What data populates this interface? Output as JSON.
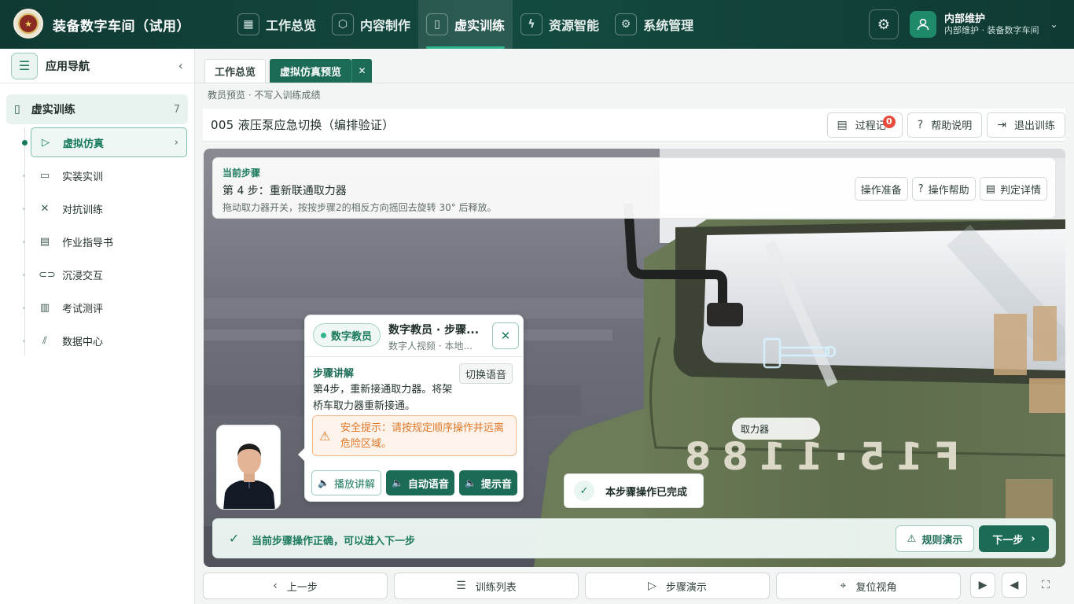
{
  "app": {
    "title": "装备数字车间（试用）",
    "logo_icon": "emblem-icon",
    "logo_glyph": "★"
  },
  "nav": {
    "items": [
      {
        "label": "工作总览",
        "icon": "grid-icon",
        "glyph": "▦"
      },
      {
        "label": "内容制作",
        "icon": "cube-icon",
        "glyph": "⬡"
      },
      {
        "label": "虚实训练",
        "icon": "book-icon",
        "glyph": "▯"
      },
      {
        "label": "资源智能",
        "icon": "bolt-icon",
        "glyph": "ϟ"
      },
      {
        "label": "系统管理",
        "icon": "gear-icon",
        "glyph": "⚙"
      }
    ],
    "active_index": 2
  },
  "header": {
    "settings_glyph": "⚙",
    "user_name": "内部维护",
    "user_sub": "内部维护 · 装备数字车间",
    "caret": "⌄"
  },
  "sidebar": {
    "title": "应用导航",
    "menu_glyph": "☰",
    "collapse_glyph": "‹",
    "group": {
      "label": "虚实训练",
      "count": "7",
      "glyph": "▯"
    },
    "items": [
      {
        "label": "虚拟仿真",
        "icon": "play-circle-icon",
        "glyph": "▷",
        "active": true
      },
      {
        "label": "实装实训",
        "icon": "monitor-icon",
        "glyph": "▭"
      },
      {
        "label": "对抗训练",
        "icon": "swords-icon",
        "glyph": "✕"
      },
      {
        "label": "作业指导书",
        "icon": "document-icon",
        "glyph": "▤"
      },
      {
        "label": "沉浸交互",
        "icon": "vr-icon",
        "glyph": "⊂⊃"
      },
      {
        "label": "考试测评",
        "icon": "clipboard-icon",
        "glyph": "▥"
      },
      {
        "label": "数据中心",
        "icon": "chart-icon",
        "glyph": "⫽"
      }
    ],
    "chevron": "›"
  },
  "tabs": {
    "items": [
      {
        "label": "工作总览"
      },
      {
        "label": "虚拟仿真预览"
      }
    ],
    "close_glyph": "✕"
  },
  "notice": "教员预览 · 不写入训练成绩",
  "page": {
    "title": "005 液压泵应急切换（编排验证）",
    "buttons": {
      "record": "过程记",
      "record_badge": "0",
      "help": "帮助说明",
      "exit": "退出训练"
    },
    "glyphs": {
      "record": "▤",
      "help": "?",
      "exit": "⇥"
    }
  },
  "step": {
    "kicker": "当前步骤",
    "title": "第 4 步：重新联通取力器",
    "desc": "拖动取力器开关，按按步骤2的相反方向摇回去旋转 30° 后释放。",
    "actions": {
      "prep": "操作准备",
      "help": "操作帮助",
      "detail": "判定详情"
    },
    "glyphs": {
      "help": "?",
      "detail": "▤"
    }
  },
  "scene": {
    "part_label": "取力器",
    "plate": "F15·1188"
  },
  "instructor": {
    "pill": "数字教员",
    "title": "数字教员 · 步骤...",
    "subtitle": "数字人视频 · 本地...",
    "close_glyph": "✕",
    "section": "步骤讲解",
    "switch": "切换语音",
    "body": "第4步，重新接通取力器。将架桥车取力器重新接通。",
    "warning": "安全提示：请按规定顺序操作并远离危险区域。",
    "warn_glyph": "⚠",
    "actions": {
      "play": "播放讲解",
      "auto": "自动语音",
      "cue": "提示音"
    },
    "speaker_glyph": "🔈"
  },
  "toast": {
    "text": "本步骤操作已完成",
    "glyph": "✓"
  },
  "status": {
    "text": "当前步骤操作正确，可以进入下一步",
    "glyph": "✓",
    "rule": "规则演示",
    "rule_glyph": "⚠",
    "next": "下一步",
    "next_glyph": "›"
  },
  "bottom": {
    "prev": "上一步",
    "prev_glyph": "‹",
    "list": "训练列表",
    "list_glyph": "☰",
    "demo": "步骤演示",
    "demo_glyph": "▷",
    "reset": "复位视角",
    "reset_glyph": "⌖",
    "icons": [
      "▶",
      "◀",
      "⛶"
    ]
  },
  "colors": {
    "brand": "#1b6b56",
    "topbar": "#0f3a33",
    "warning": "#e0782a",
    "danger": "#e64b3c"
  }
}
